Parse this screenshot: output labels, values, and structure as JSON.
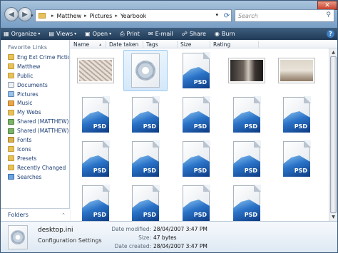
{
  "address": {
    "crumbs": [
      "Matthew",
      "Pictures",
      "Yearbook"
    ]
  },
  "search": {
    "placeholder": "Search"
  },
  "toolbar": {
    "organize": "Organize",
    "views": "Views",
    "open": "Open",
    "print": "Print",
    "email": "E-mail",
    "share": "Share",
    "burn": "Burn"
  },
  "sidebar": {
    "title": "Favorite Links",
    "items": [
      "Eng Ext Crime Fictio...",
      "Matthew",
      "Public",
      "Documents",
      "Pictures",
      "Music",
      "My Webs",
      "Shared (MATTHEW)",
      "Shared (MATTHEW)...",
      "Fonts",
      "Icons",
      "Presets",
      "Recently Changed",
      "Searches"
    ],
    "folders_label": "Folders"
  },
  "columns": [
    "Name",
    "Date taken",
    "Tags",
    "Size",
    "Rating"
  ],
  "files": {
    "psd_label": "PSD"
  },
  "details": {
    "name": "desktop.ini",
    "type": "Configuration Settings",
    "modified_label": "Date modified:",
    "modified_value": "28/04/2007 3:47 PM",
    "size_label": "Size:",
    "size_value": "47 bytes",
    "created_label": "Date created:",
    "created_value": "28/04/2007 3:47 PM"
  }
}
